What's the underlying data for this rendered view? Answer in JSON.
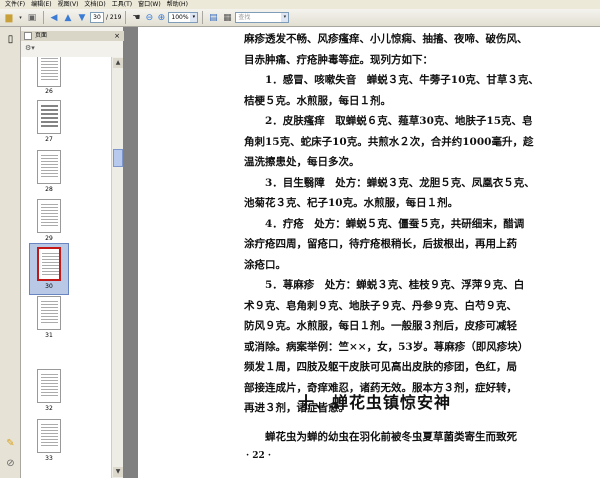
{
  "menubar": {
    "items": [
      "文件(F)",
      "编辑(E)",
      "视图(V)",
      "文档(D)",
      "工具(T)",
      "窗口(W)",
      "帮助(H)"
    ]
  },
  "toolbar": {
    "current_page": "30",
    "page_total": "/ 219",
    "zoom": "100%",
    "search_placeholder": "查找"
  },
  "panel": {
    "title": "页面",
    "close": "×"
  },
  "thumbnails": [
    {
      "label": "26"
    },
    {
      "label": "27"
    },
    {
      "label": "28"
    },
    {
      "label": "29"
    },
    {
      "label": "30",
      "selected": true
    },
    {
      "label": "31"
    },
    {
      "label": "32"
    },
    {
      "label": "33"
    }
  ],
  "document": {
    "lines": [
      "麻疹透发不畅、风疹瘙痒、小儿惊痫、抽搐、夜啼、破伤风、",
      "目赤肿痛、疔疮肿毒等症。现列方如下：",
      "　　1．感冒、咳嗽失音　蝉蜕３克、牛蒡子10克、甘草３克、",
      "桔梗５克。水煎服，每日１剂。",
      "　　2．皮肤瘙痒　取蝉蜕６克、薤草30克、地肤子15克、皂",
      "角刺15克、蛇床子10克。共煎水２次，合并约1000毫升，趁",
      "温洗擦患处，每日多次。",
      "　　3．目生翳障　处方：蝉蜕３克、龙胆５克、凤凰衣５克、",
      "池菊花３克、杞子10克。水煎服，每日１剂。",
      "　　4．疔疮　处方：蝉蜕５克、僵蚕５克，共研细末，醋调",
      "涂疔疮四周，留疮口，待疔疮根稍长，后拔根出，再用上药",
      "涂疮口。",
      "　　5．荨麻疹　处方：蝉蜕３克、桂枝９克、浮萍９克、白",
      "术９克、皂角刺９克、地肤子９克、丹参９克、白芍９克、",
      "防风９克。水煎服，每日１剂。一般服３剂后，皮疹可减轻",
      "或消除。病案举例：竺××，女，53岁。荨麻疹（即风疹块）",
      "频发１周，四肢及躯干皮肤可见高出皮肤的疹团，色红，局",
      "部接连成片，奇痒难忍，诸药无效。服本方３剂，症好转，",
      "再进３剂，诸症皆愈。"
    ],
    "heading": "十、蝉花虫镇惊安神",
    "last_line": "　　蝉花虫为蝉的幼虫在羽化前被冬虫夏草菌类寄生而致死",
    "page_number": "· 22 ·"
  }
}
